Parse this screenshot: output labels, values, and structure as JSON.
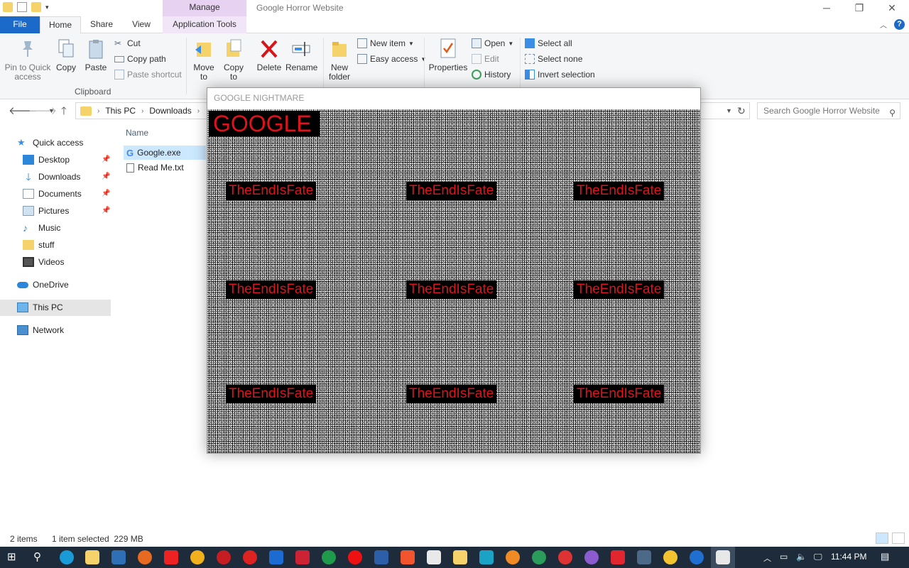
{
  "window": {
    "title": "Google Horror Website",
    "manage_tab": "Manage",
    "controls": {
      "minimize": "─",
      "restore": "❐",
      "close": "✕"
    }
  },
  "ribbon_tabs": {
    "file": "File",
    "home": "Home",
    "share": "Share",
    "view": "View",
    "application_tools": "Application Tools"
  },
  "ribbon": {
    "pin_to_quick_access": "Pin to Quick access",
    "copy": "Copy",
    "paste": "Paste",
    "cut": "Cut",
    "copy_path": "Copy path",
    "paste_shortcut": "Paste shortcut",
    "clipboard_label": "Clipboard",
    "move_to": "Move to",
    "copy_to": "Copy to",
    "delete": "Delete",
    "rename": "Rename",
    "new_folder": "New folder",
    "new_item": "New item",
    "easy_access": "Easy access",
    "properties": "Properties",
    "open": "Open",
    "edit": "Edit",
    "history": "History",
    "select_all": "Select all",
    "select_none": "Select none",
    "invert_selection": "Invert selection"
  },
  "address": {
    "crumbs": [
      "This PC",
      "Downloads"
    ],
    "search_placeholder": "Search Google Horror Website"
  },
  "nav": {
    "items": [
      {
        "label": "Quick access",
        "icon": "star-icon"
      },
      {
        "label": "Desktop",
        "icon": "desktop-icon",
        "pinned": true
      },
      {
        "label": "Downloads",
        "icon": "download-icon",
        "pinned": true
      },
      {
        "label": "Documents",
        "icon": "documents-icon",
        "pinned": true
      },
      {
        "label": "Pictures",
        "icon": "pictures-icon",
        "pinned": true
      },
      {
        "label": "Music",
        "icon": "music-icon"
      },
      {
        "label": "stuff",
        "icon": "folder-icon"
      },
      {
        "label": "Videos",
        "icon": "videos-icon"
      },
      {
        "label": "OneDrive",
        "icon": "cloud-icon"
      },
      {
        "label": "This PC",
        "icon": "computer-icon",
        "selected": true
      },
      {
        "label": "Network",
        "icon": "network-icon"
      }
    ]
  },
  "files": {
    "column_name": "Name",
    "rows": [
      {
        "name": "Google.exe",
        "selected": true
      },
      {
        "name": "Read Me.txt",
        "selected": false
      }
    ]
  },
  "status": {
    "items_count": "2 items",
    "selection": "1 item selected  229 MB"
  },
  "popup": {
    "title": "GOOGLE NIGHTMARE",
    "heading": "GOOGLE",
    "repeat_text": "TheEndIsFate",
    "accent_color": "#e0121b"
  },
  "taskbar": {
    "time": "11:44 PM"
  }
}
